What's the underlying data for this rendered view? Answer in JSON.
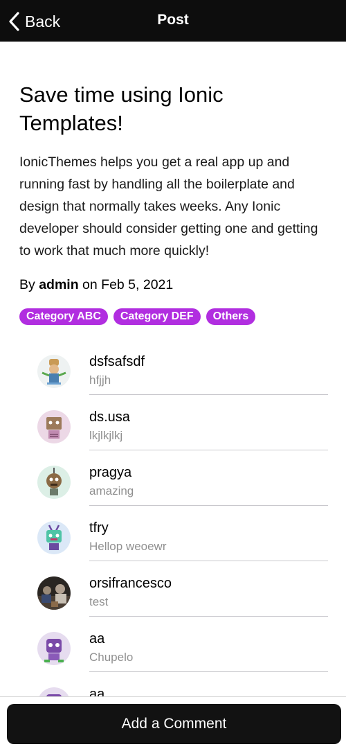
{
  "header": {
    "back_label": "Back",
    "title": "Post"
  },
  "post": {
    "title": "Save time using Ionic Templates!",
    "body": "IonicThemes helps you get a real app up and running fast by handling all the boilerplate and design that normally takes weeks. Any Ionic developer should consider getting one and getting to work that much more quickly!",
    "by_prefix": "By",
    "author": "admin",
    "on_text": "on Feb 5, 2021",
    "tags": [
      "Category ABC",
      "Category DEF",
      "Others"
    ]
  },
  "comments": [
    {
      "name": "dsfsafsdf",
      "message": "hfjjh",
      "avatar_icon": "robot-avatar-icon"
    },
    {
      "name": "ds.usa",
      "message": "lkjlkjlkj",
      "avatar_icon": "robot-avatar-icon"
    },
    {
      "name": "pragya",
      "message": "amazing",
      "avatar_icon": "robot-avatar-icon"
    },
    {
      "name": "tfry",
      "message": "Hellop weoewr",
      "avatar_icon": "robot-avatar-icon"
    },
    {
      "name": "orsifrancesco",
      "message": "test",
      "avatar_icon": "photo-avatar-icon"
    },
    {
      "name": "aa",
      "message": "Chupelo",
      "avatar_icon": "robot-avatar-icon"
    },
    {
      "name": "aa",
      "message": "",
      "avatar_icon": "robot-avatar-icon"
    }
  ],
  "footer": {
    "add_comment_label": "Add a Comment"
  },
  "colors": {
    "header_bg": "#0d0d0d",
    "tag_bg": "#b12ee0",
    "button_bg": "#121212",
    "muted_text": "#909090"
  }
}
